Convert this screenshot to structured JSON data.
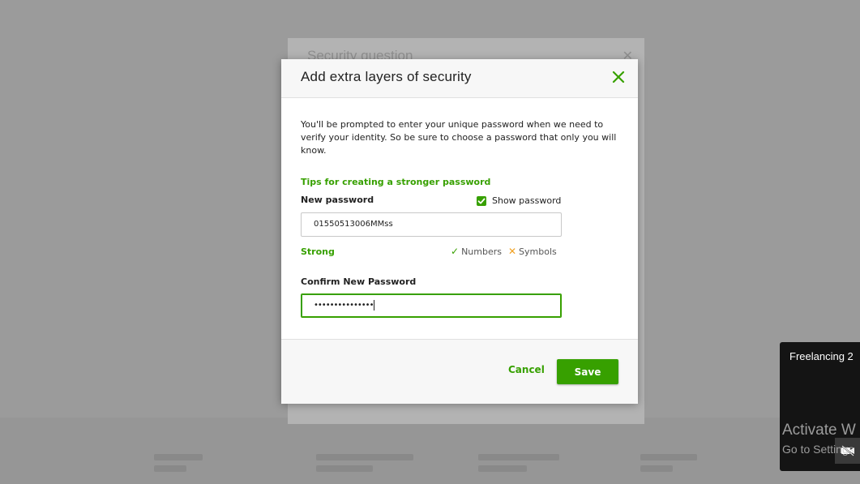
{
  "colors": {
    "accent": "#37a000",
    "warning": "#f0a020",
    "overlay": "rgba(0,0,0,0.38)"
  },
  "background_modal": {
    "title": "Security question"
  },
  "modal": {
    "title": "Add extra layers of security",
    "close_icon": "close-icon",
    "intro": "You'll be prompted to enter your unique password when we need to verify your identity. So be sure to choose a password that only you will know.",
    "tips_link": "Tips for creating a stronger password",
    "new_password": {
      "label": "New password",
      "value": "01550513006MMss",
      "show_password_label": "Show password",
      "show_password_checked": true
    },
    "strength": {
      "label": "Strong",
      "requirements": [
        {
          "label": "Numbers",
          "met": true,
          "icon": "check-icon"
        },
        {
          "label": "Symbols",
          "met": false,
          "icon": "x-icon"
        }
      ]
    },
    "confirm_password": {
      "label": "Confirm New Password",
      "masked_value": "•••••••••••••••"
    },
    "footer": {
      "cancel_label": "Cancel",
      "save_label": "Save"
    }
  },
  "video_overlay": {
    "title": "Freelancing 2"
  },
  "watermark": {
    "line1": "Activate W",
    "line2": "Go to Settings"
  }
}
